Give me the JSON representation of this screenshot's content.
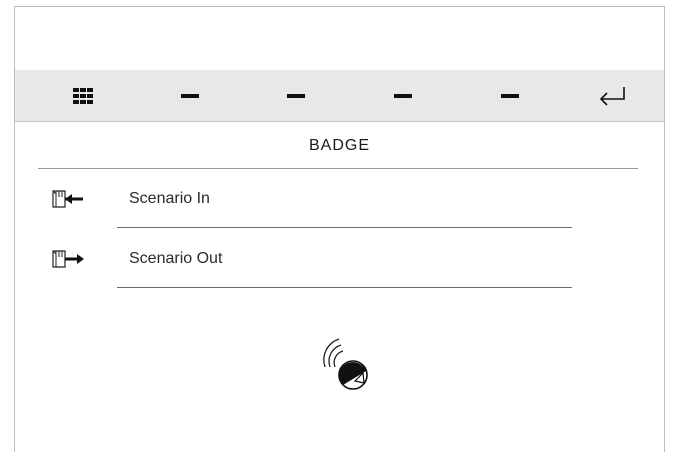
{
  "toolbar": {
    "items": [
      {
        "icon": "grid-menu-icon"
      },
      {
        "icon": "dash-icon"
      },
      {
        "icon": "dash-icon"
      },
      {
        "icon": "dash-icon"
      },
      {
        "icon": "dash-icon"
      },
      {
        "icon": "back-return-icon"
      }
    ]
  },
  "page": {
    "title": "BADGE"
  },
  "scenarios": [
    {
      "label": "Scenario In",
      "icon": "door-enter-icon"
    },
    {
      "label": "Scenario Out",
      "icon": "door-exit-icon"
    }
  ],
  "badge_reader": {
    "icon": "nfc-badge-icon"
  },
  "colors": {
    "toolbar_bg": "#e8e8e8",
    "text": "#1a1a1a",
    "rule": "#6a6a6a"
  }
}
